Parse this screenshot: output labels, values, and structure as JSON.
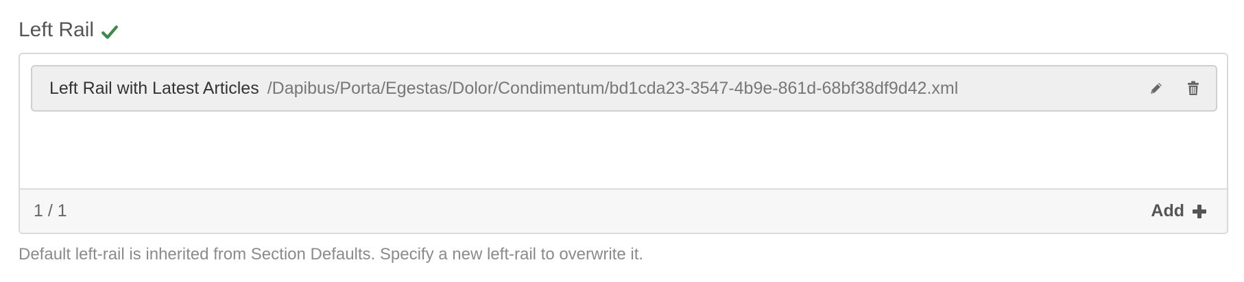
{
  "field": {
    "label": "Left Rail",
    "status_icon": "checkmark-icon",
    "status_color": "#3d8b4a"
  },
  "list": {
    "items": [
      {
        "name": "Left Rail with Latest Articles",
        "path": "/Dapibus/Porta/Egestas/Dolor/Condimentum/bd1cda23-3547-4b9e-861d-68bf38df9d42.xml",
        "actions": [
          "pencil-icon",
          "trash-icon"
        ]
      }
    ],
    "footer": {
      "count": "1 / 1",
      "add_label": "Add",
      "add_icon": "plus-icon"
    }
  },
  "help_text": "Default left-rail is inherited from Section Defaults. Specify a new left-rail to overwrite it."
}
